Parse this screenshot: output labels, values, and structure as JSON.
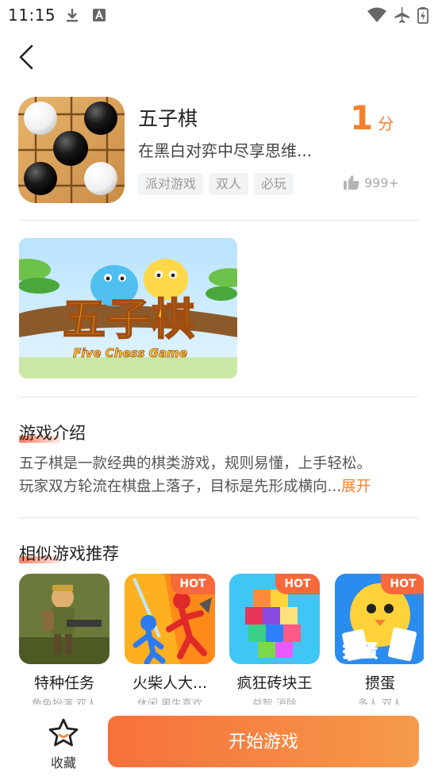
{
  "status_bar": {
    "time": "11:15",
    "icons": [
      "download-icon",
      "notification-a-icon",
      "wifi-icon",
      "airplane-mode-icon",
      "battery-charging-icon"
    ]
  },
  "nav": {
    "back_icon": "chevron-left-icon"
  },
  "game": {
    "title": "五子棋",
    "description": "在黑白对弈中尽享思维...",
    "score_value": "1",
    "score_unit": "分",
    "tags": [
      "派对游戏",
      "双人",
      "必玩"
    ],
    "likes": "999+",
    "icon_name": "gomoku-board-icon"
  },
  "banner": {
    "main_text": "五子棋",
    "sub_text": "Five Chess Game"
  },
  "intro": {
    "heading": "游戏介绍",
    "line1": "五子棋是一款经典的棋类游戏，规则易懂，上手轻松。",
    "line2": "玩家双方轮流在棋盘上落子，目标是先形成横向...",
    "expand_label": "展开"
  },
  "similar": {
    "heading": "相似游戏推荐",
    "items": [
      {
        "name": "特种任务",
        "sub": "角色扮演 双人",
        "hot": ""
      },
      {
        "name": "火柴人大...",
        "sub": "休闲 男生喜欢",
        "hot": "HOT"
      },
      {
        "name": "疯狂砖块王",
        "sub": "益智 消除",
        "hot": "HOT"
      },
      {
        "name": "掼蛋",
        "sub": "多人 双人",
        "hot": "HOT"
      }
    ]
  },
  "thumb_texts": {
    "guandan_logo": "掼蛋"
  },
  "bottom": {
    "favorite_label": "收藏",
    "start_label": "开始游戏"
  },
  "colors": {
    "accent": "#f5812c",
    "hot_badge": "#f7683a",
    "button_start": "#f7703c",
    "button_end": "#f59a4a"
  }
}
